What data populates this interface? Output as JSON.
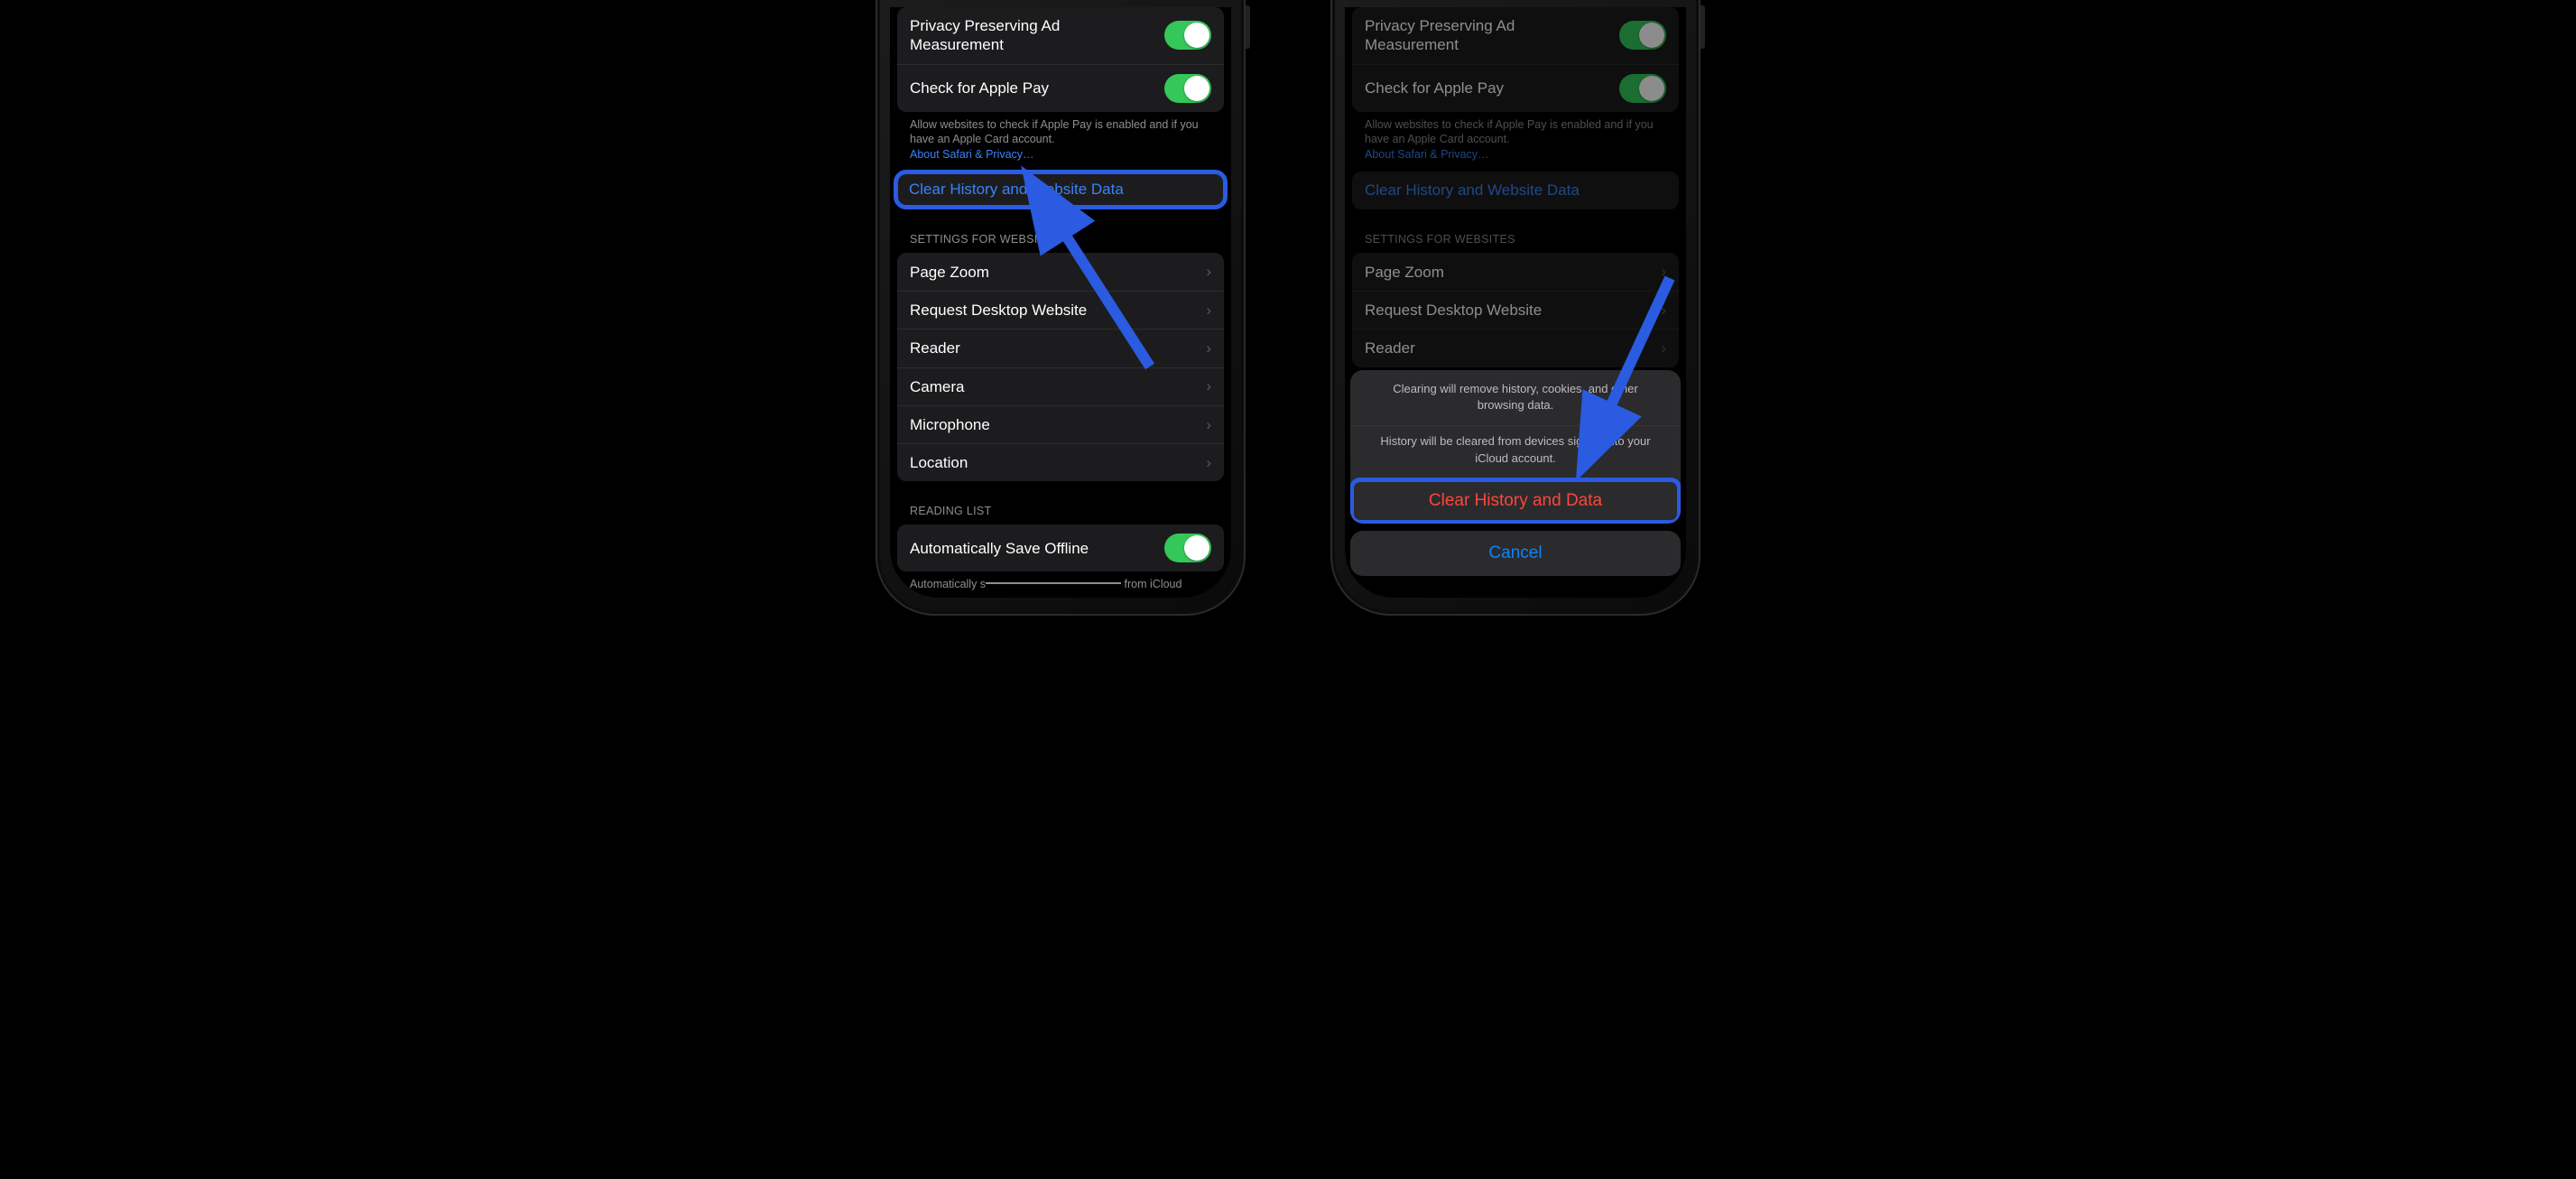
{
  "settings": {
    "privacy_ad_label": "Privacy Preserving Ad Measurement",
    "apple_pay_label": "Check for Apple Pay",
    "apple_pay_note": "Allow websites to check if Apple Pay is enabled and if you have an Apple Card account.",
    "about_link": "About Safari & Privacy…",
    "clear_history_label": "Clear History and Website Data",
    "websites_header": "SETTINGS FOR WEBSITES",
    "websites_items": [
      "Page Zoom",
      "Request Desktop Website",
      "Reader",
      "Camera",
      "Microphone",
      "Location"
    ],
    "reading_list_header": "READING LIST",
    "auto_offline_label": "Automatically Save Offline",
    "auto_offline_note_prefix": "Automatically s",
    "auto_offline_note_suffix": " from iCloud"
  },
  "sheet": {
    "msg1": "Clearing will remove history, cookies, and other browsing data.",
    "msg2": "History will be cleared from devices signed into your iCloud account.",
    "clear_action": "Clear History and Data",
    "cancel": "Cancel"
  },
  "colors": {
    "highlight": "#2a5be0",
    "destructive": "#ff453a",
    "link": "#0a84ff",
    "toggle_on": "#34c759"
  }
}
